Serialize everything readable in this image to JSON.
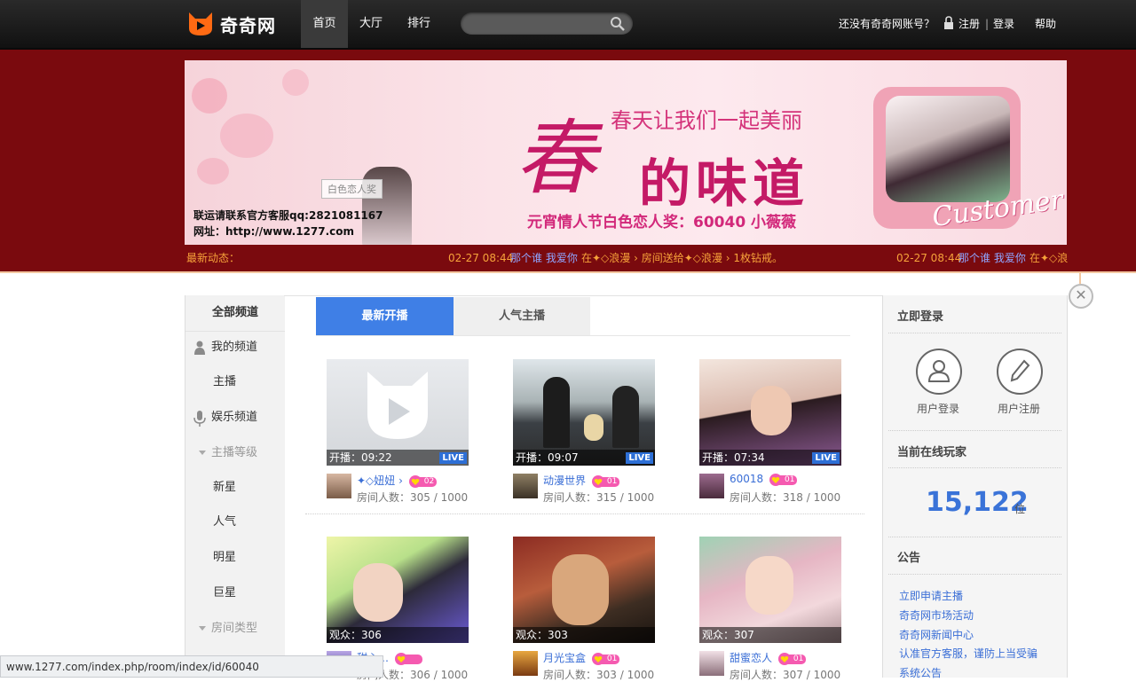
{
  "header": {
    "logo_text": "奇奇网",
    "nav": [
      {
        "label": "首页",
        "active": true
      },
      {
        "label": "大厅",
        "active": false
      },
      {
        "label": "排行",
        "active": false
      }
    ],
    "search_placeholder": "",
    "no_account": "还没有奇奇网账号？",
    "register": "注册",
    "separator": "|",
    "login": "登录",
    "help": "帮助"
  },
  "banner": {
    "headline_big1": "春",
    "headline_big2": "的味道",
    "tagline": "春天让我们一起美丽",
    "award": "元宵情人节白色恋人奖：60040 小薇薇",
    "stamp": "白色恋人奖",
    "contact_line1": "联运请联系官方客服qq:2821081167",
    "contact_line2": "网址：http://www.1277.com",
    "badge_text": "Customer"
  },
  "ticker": {
    "label": "最新动态：",
    "items": [
      {
        "time": "02-27 08:44",
        "user": "那个谁 我爱你",
        "text": "在✦◇浪漫 › 房间送给✦◇浪漫 › 1枚钻戒。"
      },
      {
        "time": "02-27 08:44",
        "user": "那个谁 我爱你",
        "text": "在✦◇浪漫"
      }
    ]
  },
  "sidebar": {
    "title": "全部频道",
    "items": [
      {
        "label": "我的频道",
        "icon": "person-icon"
      },
      {
        "label": "主播"
      },
      {
        "label": "娱乐频道",
        "icon": "microphone-icon"
      },
      {
        "label": "主播等级",
        "muted": true,
        "icon": "triangle-down-icon"
      },
      {
        "label": "新星"
      },
      {
        "label": "人气"
      },
      {
        "label": "明星"
      },
      {
        "label": "巨星"
      },
      {
        "label": "房间类型",
        "muted": true,
        "icon": "triangle-down-icon"
      }
    ]
  },
  "tabs": [
    {
      "label": "最新开播",
      "active": true
    },
    {
      "label": "人气主播",
      "active": false
    }
  ],
  "cards": [
    {
      "overlay": "开播：09:22",
      "live": "LIVE",
      "name": "✦◇妞妞 ›",
      "level": "02",
      "count": "房间人数：305 / 1000",
      "thumb": "placeholder"
    },
    {
      "overlay": "开播：09:07",
      "live": "LIVE",
      "name": "动漫世界",
      "level": "01",
      "count": "房间人数：315 / 1000",
      "thumb": "anime"
    },
    {
      "overlay": "开播：07:34",
      "live": "LIVE",
      "name": "60018",
      "level": "01",
      "count": "房间人数：318 / 1000",
      "thumb": "girl1"
    },
    {
      "overlay": "观众：306",
      "live": "",
      "name": "甜心…",
      "level": "",
      "count": "房间人数：306 / 1000",
      "thumb": "girl2"
    },
    {
      "overlay": "观众：303",
      "live": "",
      "name": "月光宝盒",
      "level": "01",
      "count": "房间人数：303 / 1000",
      "thumb": "movie"
    },
    {
      "overlay": "观众：307",
      "live": "",
      "name": "甜蜜恋人",
      "level": "01",
      "count": "房间人数：307 / 1000",
      "thumb": "girl3"
    }
  ],
  "right": {
    "login_title": "立即登录",
    "user_login": "用户登录",
    "user_register": "用户注册",
    "online_title": "当前在线玩家",
    "online_count": "15,122",
    "online_unit": "位",
    "notice_title": "公告",
    "notices": [
      "立即申请主播",
      "奇奇网市场活动",
      "奇奇网新闻中心",
      "认准官方客服，谨防上当受骗",
      "系统公告"
    ]
  },
  "status_url": "www.1277.com/index.php/room/index/id/60040",
  "colors": {
    "banner_zone": "#7a0a0e",
    "accent_blue": "#3f7fe6",
    "ticker_orange": "#f6a23a"
  }
}
